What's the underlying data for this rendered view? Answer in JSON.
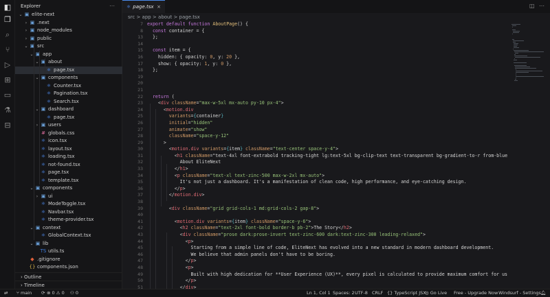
{
  "sidebar": {
    "title": "Explorer",
    "tree": [
      {
        "label": "elite-next",
        "type": "folder",
        "open": true,
        "depth": 0
      },
      {
        "label": ".next",
        "type": "folder",
        "open": false,
        "depth": 1
      },
      {
        "label": "node_modules",
        "type": "folder",
        "open": false,
        "depth": 1
      },
      {
        "label": "public",
        "type": "folder",
        "open": false,
        "depth": 1
      },
      {
        "label": "src",
        "type": "folder",
        "open": true,
        "depth": 1
      },
      {
        "label": "app",
        "type": "folder",
        "open": true,
        "depth": 2
      },
      {
        "label": "about",
        "type": "folder",
        "open": true,
        "depth": 3
      },
      {
        "label": "page.tsx",
        "type": "tsx",
        "depth": 4,
        "selected": true
      },
      {
        "label": "components",
        "type": "folder",
        "open": true,
        "depth": 3
      },
      {
        "label": "Counter.tsx",
        "type": "tsx",
        "depth": 4
      },
      {
        "label": "Pagination.tsx",
        "type": "tsx",
        "depth": 4
      },
      {
        "label": "Search.tsx",
        "type": "tsx",
        "depth": 4
      },
      {
        "label": "dashboard",
        "type": "folder",
        "open": true,
        "depth": 3
      },
      {
        "label": "page.tsx",
        "type": "tsx",
        "depth": 4
      },
      {
        "label": "users",
        "type": "folder",
        "open": false,
        "depth": 3
      },
      {
        "label": "globals.css",
        "type": "css",
        "depth": 3
      },
      {
        "label": "icon.tsx",
        "type": "tsx",
        "depth": 3
      },
      {
        "label": "layout.tsx",
        "type": "tsx",
        "depth": 3
      },
      {
        "label": "loading.tsx",
        "type": "tsx",
        "depth": 3
      },
      {
        "label": "not-found.tsx",
        "type": "tsx",
        "depth": 3
      },
      {
        "label": "page.tsx",
        "type": "tsx",
        "depth": 3
      },
      {
        "label": "template.tsx",
        "type": "tsx",
        "depth": 3
      },
      {
        "label": "components",
        "type": "folder",
        "open": true,
        "depth": 2
      },
      {
        "label": "ui",
        "type": "folder",
        "open": false,
        "depth": 3
      },
      {
        "label": "ModeToggle.tsx",
        "type": "tsx",
        "depth": 3
      },
      {
        "label": "Navbar.tsx",
        "type": "tsx",
        "depth": 3
      },
      {
        "label": "theme-provider.tsx",
        "type": "tsx",
        "depth": 3
      },
      {
        "label": "context",
        "type": "folder",
        "open": true,
        "depth": 2
      },
      {
        "label": "GlobalContext.tsx",
        "type": "tsx",
        "depth": 3
      },
      {
        "label": "lib",
        "type": "folder",
        "open": true,
        "depth": 2
      },
      {
        "label": "utils.ts",
        "type": "ts",
        "depth": 3
      },
      {
        "label": ".gitignore",
        "type": "git",
        "depth": 1
      },
      {
        "label": "components.json",
        "type": "json",
        "depth": 1
      }
    ],
    "outline": "Outline",
    "timeline": "Timeline"
  },
  "tab": {
    "label": "page.tsx",
    "close": "×"
  },
  "breadcrumb": "src > app > about > page.tsx",
  "editor": {
    "lines": [
      {
        "n": "7",
        "code": "export default function AboutPage() {"
      },
      {
        "n": "8",
        "code": "  const container = {"
      },
      {
        "n": "13",
        "code": "  };"
      },
      {
        "n": "14",
        "code": ""
      },
      {
        "n": "15",
        "code": "  const item = {"
      },
      {
        "n": "16",
        "code": "    hidden: { opacity: 0, y: 20 },"
      },
      {
        "n": "17",
        "code": "    show: { opacity: 1, y: 0 },"
      },
      {
        "n": "18",
        "code": "  };"
      },
      {
        "n": "19",
        "code": ""
      },
      {
        "n": "20",
        "code": ""
      },
      {
        "n": "21",
        "code": ""
      },
      {
        "n": "22",
        "code": "  return ("
      },
      {
        "n": "23",
        "code": "    <div className=\"max-w-5xl mx-auto py-10 px-4\">"
      },
      {
        "n": "24",
        "code": "      <motion.div"
      },
      {
        "n": "25",
        "code": "        variants={container}"
      },
      {
        "n": "26",
        "code": "        initial=\"hidden\""
      },
      {
        "n": "27",
        "code": "        animate=\"show\""
      },
      {
        "n": "28",
        "code": "        className=\"space-y-12\""
      },
      {
        "n": "29",
        "code": "      >"
      },
      {
        "n": "30",
        "code": "        <motion.div variants={item} className=\"text-center space-y-4\">"
      },
      {
        "n": "31",
        "code": "          <h1 className=\"text-4xl font-extrabold tracking-tight lg:text-5xl bg-clip-text text-transparent bg-gradient-to-r from-blue"
      },
      {
        "n": "32",
        "code": "            About EliteNext"
      },
      {
        "n": "33",
        "code": "          </h1>"
      },
      {
        "n": "34",
        "code": "          <p className=\"text-xl text-zinc-500 max-w-2xl mx-auto\">"
      },
      {
        "n": "35",
        "code": "            It's not just a dashboard. It's a manifestation of clean code, high performance, and eye-catching design."
      },
      {
        "n": "36",
        "code": "          </p>"
      },
      {
        "n": "37",
        "code": "        </motion.div>"
      },
      {
        "n": "38",
        "code": ""
      },
      {
        "n": "39",
        "code": "        <div className=\"grid grid-cols-1 md:grid-cols-2 gap-8\">"
      },
      {
        "n": "40",
        "code": ""
      },
      {
        "n": "41",
        "code": "          <motion.div variants={item} className=\"space-y-6\">"
      },
      {
        "n": "42",
        "code": "            <h2 className=\"text-2xl font-bold border-b pb-2\">The Story</h2>"
      },
      {
        "n": "43",
        "code": "            <div className=\"prose dark:prose-invert text-zinc-600 dark:text-zinc-300 leading-relaxed\">"
      },
      {
        "n": "44",
        "code": "              <p>"
      },
      {
        "n": "45",
        "code": "                Starting from a simple line of code, EliteNext has evolved into a new standard in modern dashboard development."
      },
      {
        "n": "46",
        "code": "                We believe that admin panels don't have to be boring."
      },
      {
        "n": "47",
        "code": "              </p>"
      },
      {
        "n": "48",
        "code": "              <p>"
      },
      {
        "n": "49",
        "code": "                Built with high dedication for **User Experience (UX)**, every pixel is calculated to provide maximum comfort for us"
      },
      {
        "n": "50",
        "code": "              </p>"
      },
      {
        "n": "51",
        "code": "            </div>"
      },
      {
        "n": "52",
        "code": "          </motion.div>"
      }
    ]
  },
  "status": {
    "branch": "main",
    "problems": "0",
    "warnings": "0",
    "ports": "0",
    "position": "Ln 1, Col 1",
    "spaces": "Spaces: 2",
    "encoding": "UTF-8",
    "eol": "CRLF",
    "language": "TypeScript JSX",
    "golive": "Go Live",
    "upgrade": "Free - Upgrade Now",
    "settings": "Windsurf - Settings"
  },
  "colors": {
    "accent": "#4c8cf0",
    "background": "#19191c",
    "sidebar": "#151517"
  }
}
